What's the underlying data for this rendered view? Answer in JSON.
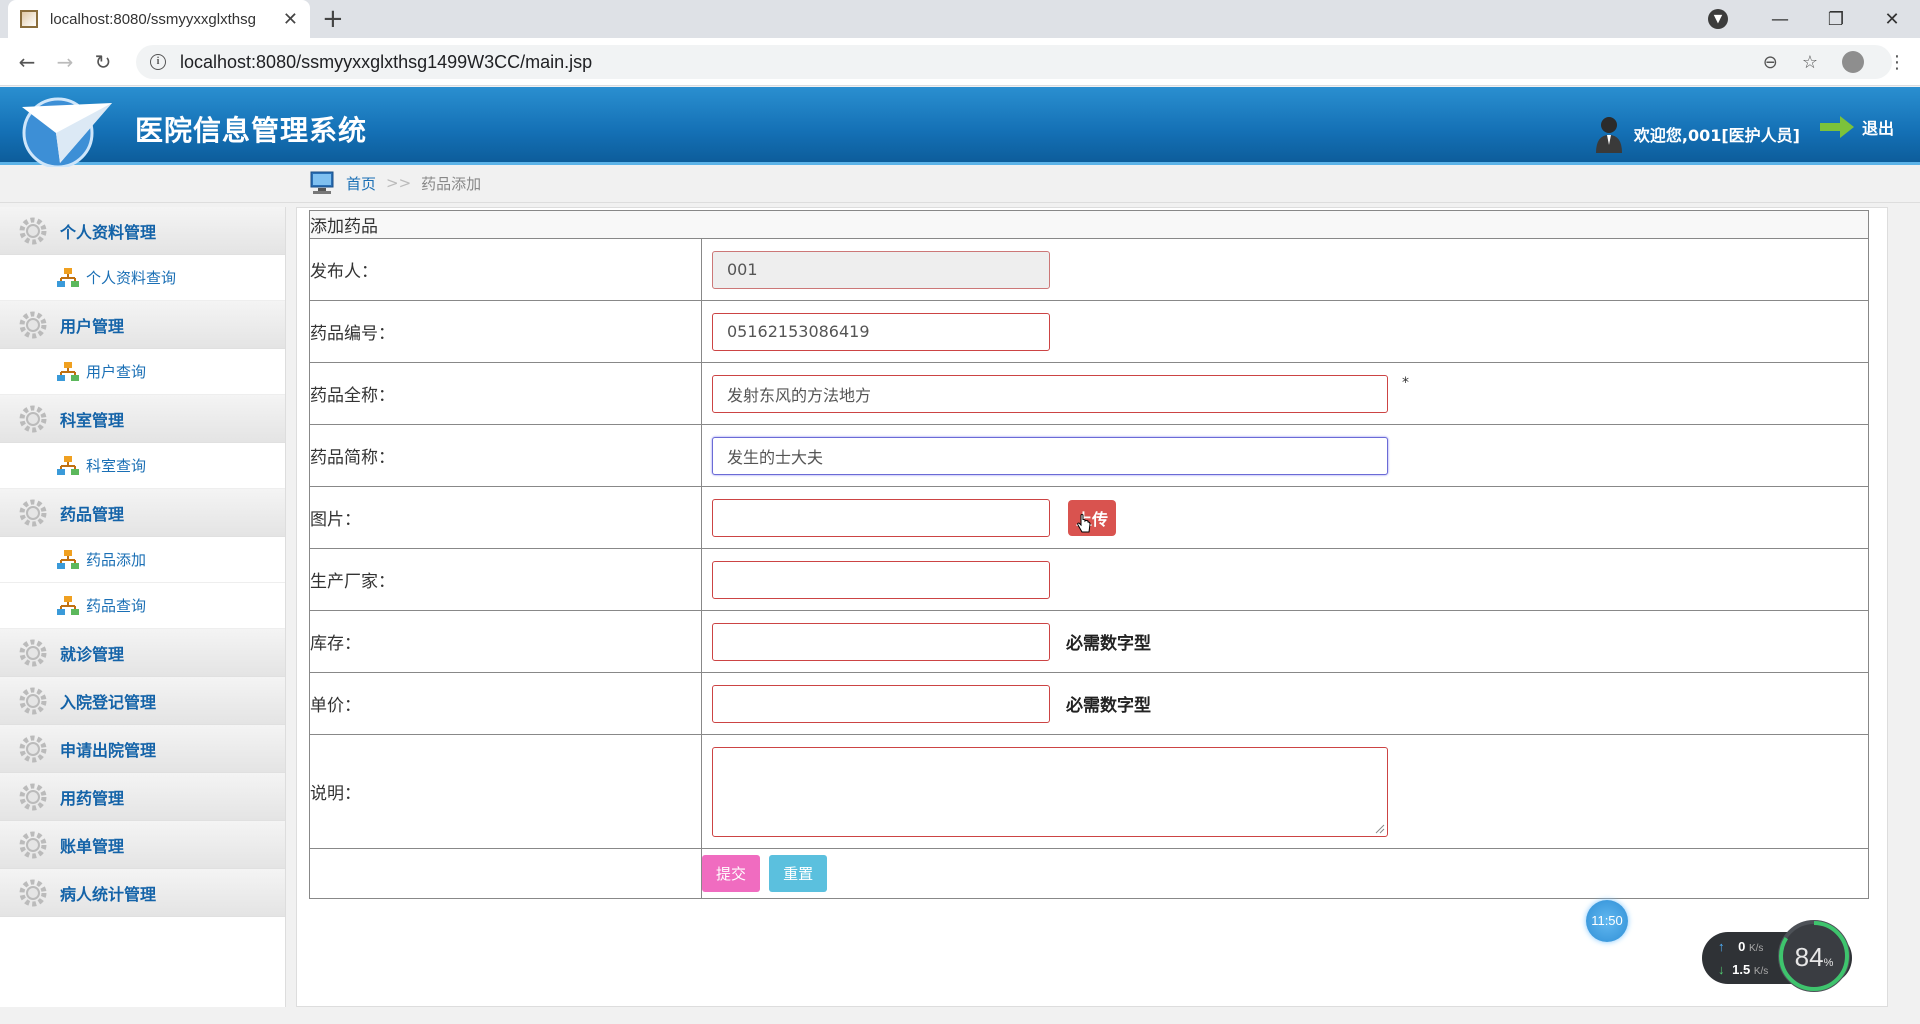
{
  "browser": {
    "tab_title": "localhost:8080/ssmyyxxglxthsg",
    "new_tab_label": "+",
    "url": "localhost:8080/ssmyyxxglxthsg1499W3CC/main.jsp"
  },
  "header": {
    "system_name": "医院信息管理系统",
    "welcome": "欢迎您,001[医护人员]",
    "logout": "退出"
  },
  "breadcrumb": {
    "home": "首页",
    "separator": ">>",
    "current": "药品添加"
  },
  "sidebar": {
    "groups": [
      {
        "label": "个人资料管理",
        "items": [
          "个人资料查询"
        ]
      },
      {
        "label": "用户管理",
        "items": [
          "用户查询"
        ]
      },
      {
        "label": "科室管理",
        "items": [
          "科室查询"
        ]
      },
      {
        "label": "药品管理",
        "items": [
          "药品添加",
          "药品查询"
        ]
      },
      {
        "label": "就诊管理",
        "items": []
      },
      {
        "label": "入院登记管理",
        "items": []
      },
      {
        "label": "申请出院管理",
        "items": []
      },
      {
        "label": "用药管理",
        "items": []
      },
      {
        "label": "账单管理",
        "items": []
      },
      {
        "label": "病人统计管理",
        "items": []
      }
    ]
  },
  "form": {
    "caption": "添加药品",
    "fields": {
      "publisher": {
        "label": "发布人：",
        "value": "001"
      },
      "code": {
        "label": "药品编号：",
        "value": "05162153086419"
      },
      "full_name": {
        "label": "药品全称：",
        "value": "发射东风的方法地方",
        "required_mark": "*"
      },
      "short_name": {
        "label": "药品简称：",
        "value": "发生的士大夫"
      },
      "image": {
        "label": "图片：",
        "value": "",
        "upload_label": "上传"
      },
      "maker": {
        "label": "生产厂家：",
        "value": ""
      },
      "stock": {
        "label": "库存：",
        "value": "",
        "hint": "必需数字型"
      },
      "price": {
        "label": "单价：",
        "value": "",
        "hint": "必需数字型"
      },
      "desc": {
        "label": "说明：",
        "value": ""
      }
    },
    "submit_label": "提交",
    "reset_label": "重置"
  },
  "widgets": {
    "clock": "11:50",
    "net_up": "0",
    "net_down": "1.5",
    "net_unit": "K/s",
    "cpu_percent": "84",
    "cpu_unit": "%"
  },
  "colors": {
    "header_blue": "#1470b5",
    "menu_text": "#1463a8",
    "submit": "#f06cc0",
    "reset": "#5bc0de",
    "upload": "#d9534f"
  }
}
